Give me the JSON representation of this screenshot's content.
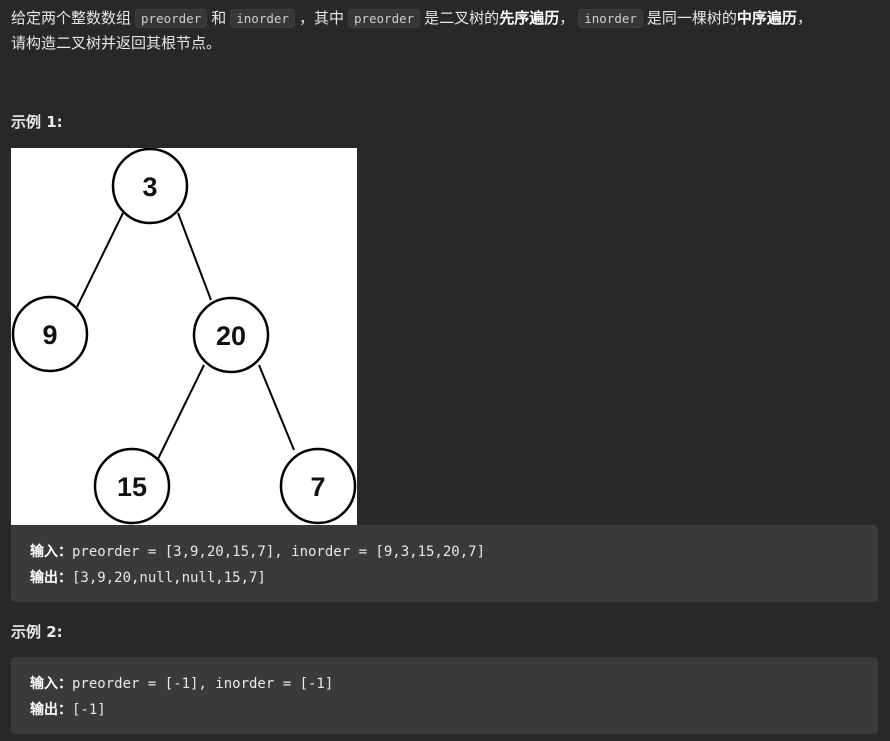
{
  "description": {
    "part1": "给定两个整数数组",
    "code_preorder": "preorder",
    "part2": "和",
    "code_inorder": "inorder",
    "part3": "，其中",
    "code_preorder2": "preorder",
    "part4": "是二叉树的",
    "bold1": "先序遍历",
    "part5": "，",
    "code_inorder2": "inorder",
    "part6": "是同一棵树的",
    "bold2": "中序遍历",
    "part7": "，",
    "line2": "请构造二叉树并返回其根节点。"
  },
  "example1": {
    "title": "示例 1:",
    "tree_nodes": [
      "3",
      "9",
      "20",
      "15",
      "7"
    ],
    "input_label": "输入：",
    "input_value": "preorder = [3,9,20,15,7], inorder = [9,3,15,20,7]",
    "output_label": "输出：",
    "output_value": "[3,9,20,null,null,15,7]"
  },
  "example2": {
    "title": "示例 2:",
    "input_label": "输入：",
    "input_value": "preorder = [-1], inorder = [-1]",
    "output_label": "输出：",
    "output_value": "[-1]"
  }
}
